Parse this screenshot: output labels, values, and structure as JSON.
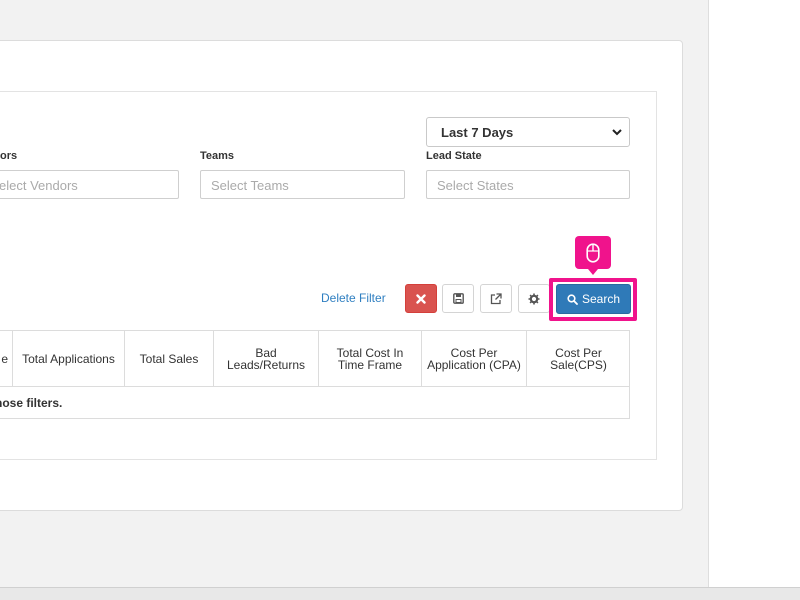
{
  "filters": {
    "vendors": {
      "label": "ors",
      "placeholder": "elect Vendors"
    },
    "teams": {
      "label": "Teams",
      "placeholder": "Select Teams"
    },
    "lead_state": {
      "label": "Lead State",
      "placeholder": "Select States"
    },
    "timeframe": {
      "selected": "Last 7 Days"
    }
  },
  "toolbar": {
    "delete_filter": "Delete Filter",
    "search_label": "Search",
    "icons": {
      "clear": "times-icon",
      "save": "save-icon",
      "export": "external-link-icon",
      "settings": "gear-icon",
      "search": "search-icon"
    }
  },
  "table": {
    "headers": [
      "e",
      "Total Applications",
      "Total Sales",
      "Bad Leads/Returns",
      "Total Cost In Time Frame",
      "Cost Per Application (CPA)",
      "Cost Per Sale(CPS)"
    ],
    "empty_message": "those filters."
  },
  "colors": {
    "accent": "#2f7ab8",
    "danger": "#d9534f",
    "highlight": "#f0138c",
    "link": "#2f7fc1"
  }
}
